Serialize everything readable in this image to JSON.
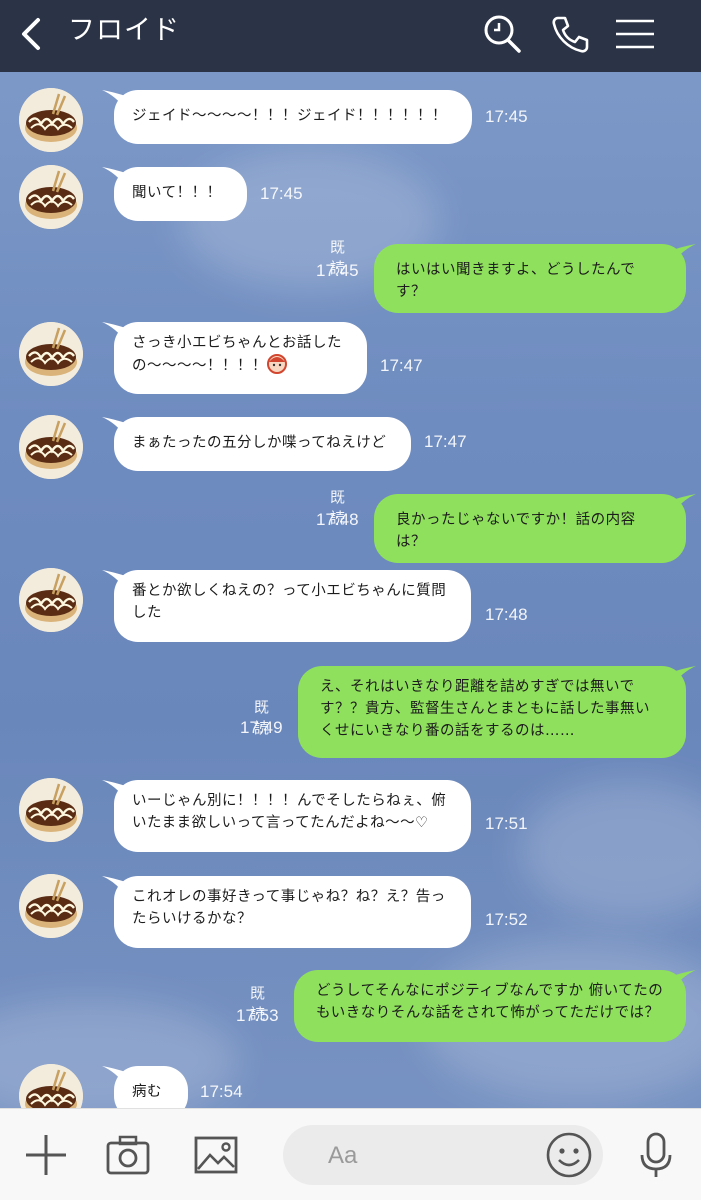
{
  "header": {
    "title": "フロイド",
    "icons": [
      "back-chevron-icon",
      "search-icon",
      "phone-icon",
      "menu-icon"
    ]
  },
  "messages": [
    {
      "side": "in",
      "text": "ジェイド〜〜〜〜！！！ジェイド！！！！！！",
      "time": "17:45"
    },
    {
      "side": "in",
      "text": "聞いて！！！",
      "time": "17:45"
    },
    {
      "side": "out",
      "text": "はいはい聞きますよ、どうしたんです？",
      "time": "17:45",
      "read": "既読"
    },
    {
      "side": "in",
      "text": "さっき小エビちゃんとお話したの〜〜〜〜！！！！",
      "time": "17:47",
      "emoji": "face-icon"
    },
    {
      "side": "in",
      "text": "まぁたったの五分しか喋ってねえけど",
      "time": "17:47"
    },
    {
      "side": "out",
      "text": "良かったじゃないですか！話の内容は？",
      "time": "17:48",
      "read": "既読"
    },
    {
      "side": "in",
      "text": "番とか欲しくねえの？って小エビちゃんに質問した",
      "time": "17:48"
    },
    {
      "side": "out",
      "text": "え、それはいきなり距離を詰めすぎでは無いです？？貴方、監督生さんとまともに話した事無いくせにいきなり番の話をするのは……",
      "time": "17:49",
      "read": "既読"
    },
    {
      "side": "in",
      "text": "いーじゃん別に！！！！んでそしたらねぇ、俯いたまま欲しいって言ってたんだよね〜〜♡",
      "time": "17:51"
    },
    {
      "side": "in",
      "text": "これオレの事好きって事じゃね？ね？え？告ったらいけるかな？",
      "time": "17:52"
    },
    {
      "side": "out",
      "text": "どうしてそんなにポジティブなんですか 俯いてたのもいきなりそんな話をされて怖がってただけでは？",
      "time": "17:53",
      "read": "既読"
    },
    {
      "side": "in",
      "text": "病む",
      "time": "17:54"
    }
  ],
  "input": {
    "placeholder": "Aa"
  },
  "bottom_icons": [
    "plus-icon",
    "camera-icon",
    "image-icon",
    "emoji-icon",
    "microphone-icon"
  ],
  "colors": {
    "header": "#2b3346",
    "outgoing_bubble": "#8fe05c",
    "incoming_bubble": "#ffffff",
    "background": "#7393c4"
  }
}
